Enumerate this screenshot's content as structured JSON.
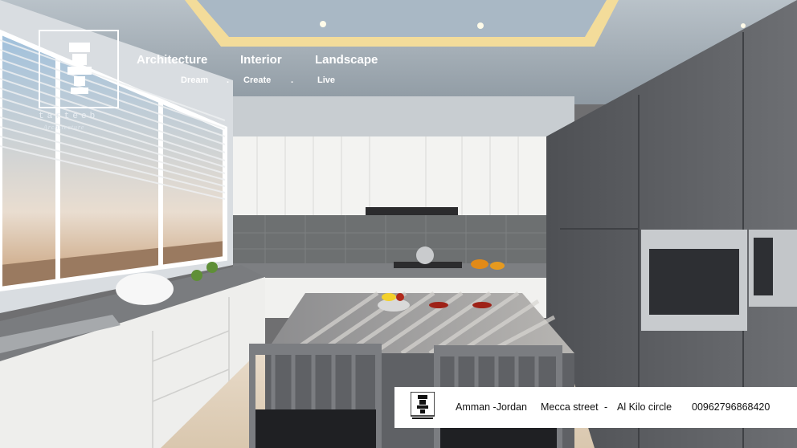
{
  "brand": {
    "name": "tarteeb",
    "subtitle": "Architecture"
  },
  "nav": {
    "items": [
      {
        "label": "Architecture"
      },
      {
        "label": "Interior"
      },
      {
        "label": "Landscape"
      }
    ],
    "tagline": [
      "Dream",
      ".",
      "Create",
      ".",
      "Live"
    ]
  },
  "contact": {
    "brand_name": "tarteeb",
    "address_city": "Amman  -Jordan",
    "address_street": "Mecca street",
    "separator": "-",
    "address_landmark": "Al Kilo circle",
    "phone": "00962796868420"
  },
  "colors": {
    "accent_light": "#f2d27a",
    "cabinet_dark": "#5f6165",
    "cabinet_white": "#f3f3f1"
  }
}
